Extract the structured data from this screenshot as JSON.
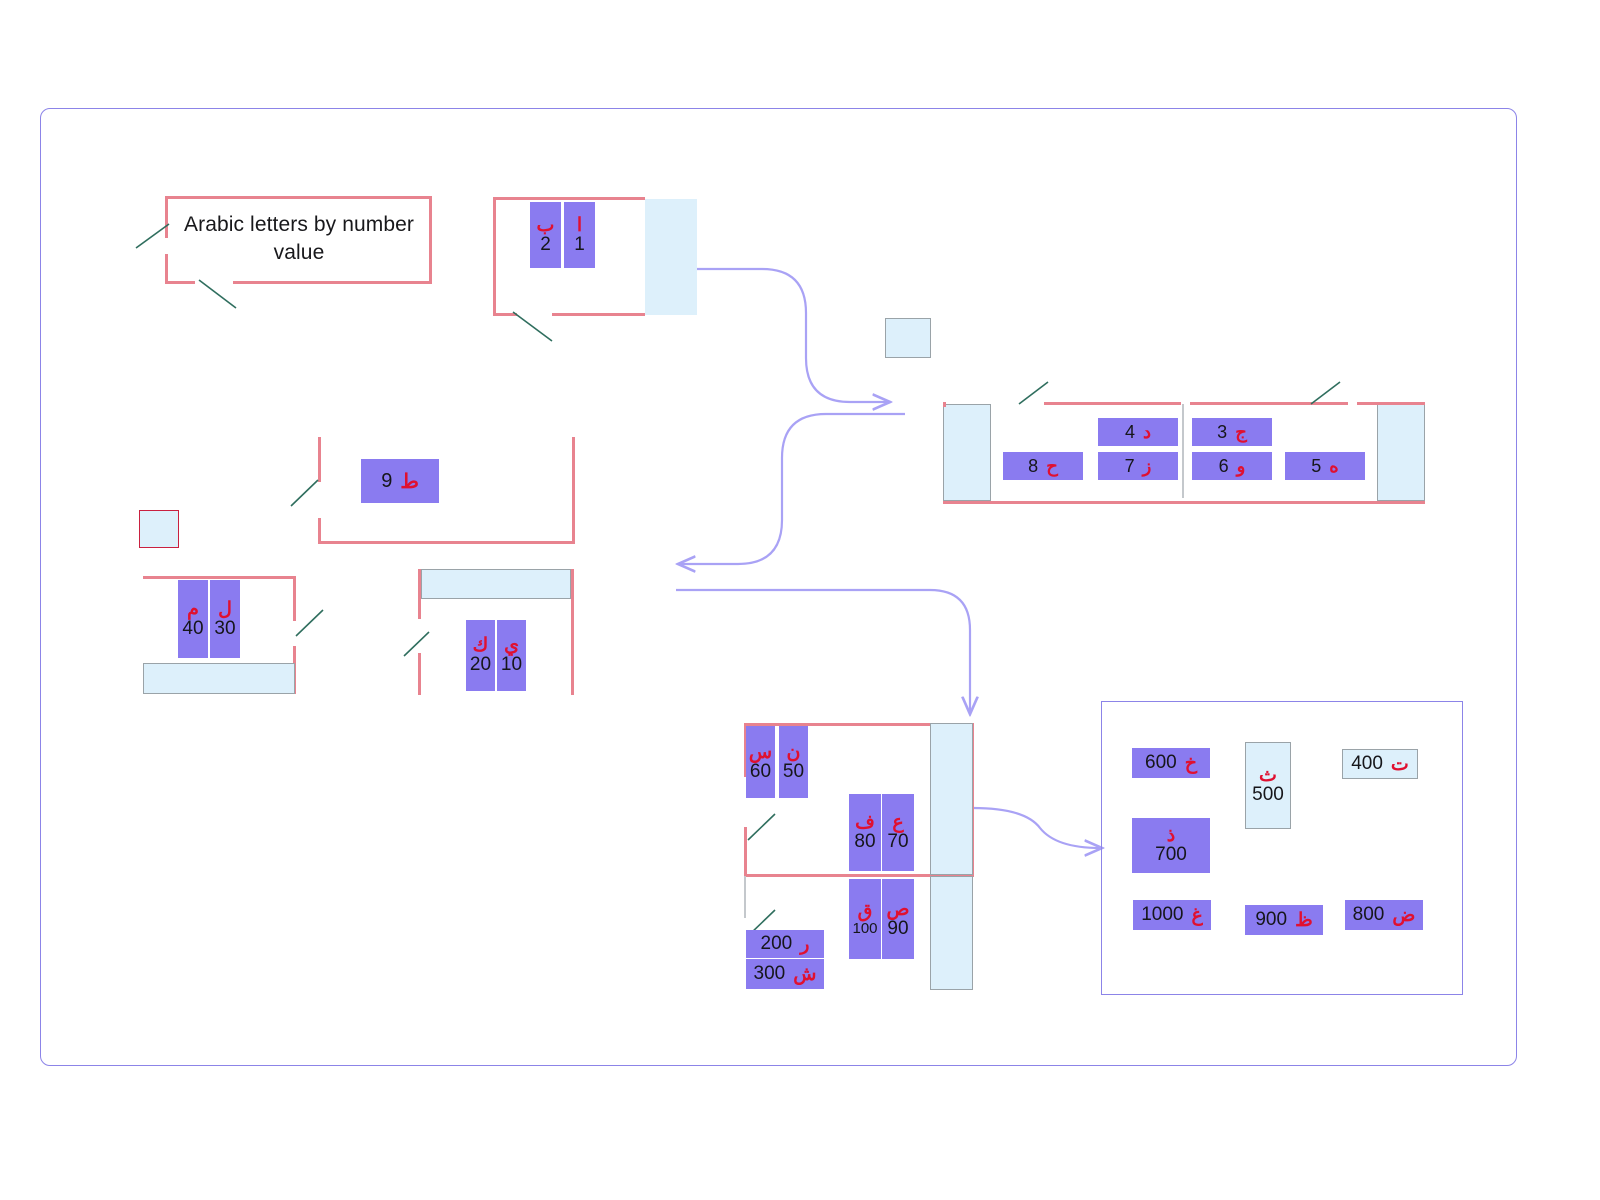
{
  "diagram": {
    "title": "Arabic letters by number value",
    "colors": {
      "chip_purple": "#8a7bf0",
      "chip_blue": "#ddf0fb",
      "letter_red": "#e01030",
      "frame_pink": "#e8838f",
      "frame_darkpink": "#c9203f",
      "connector_purple": "#a9a2f5",
      "leader_green": "#2f6e5e",
      "outer_border": "#8c84e8"
    }
  },
  "groups": {
    "ones_1_2": {
      "name": "ones-1-2",
      "chips": [
        {
          "letter": "ب",
          "value": "2"
        },
        {
          "letter": "ا",
          "value": "1"
        }
      ]
    },
    "ones_3_8": {
      "name": "ones-3-8",
      "chips_left": [
        {
          "letter": "د",
          "value": "4"
        },
        {
          "letter": "ح",
          "value": "8"
        },
        {
          "letter": "ز",
          "value": "7"
        }
      ],
      "chips_right": [
        {
          "letter": "ج",
          "value": "3"
        },
        {
          "letter": "و",
          "value": "6"
        },
        {
          "letter": "ه",
          "value": "5"
        }
      ]
    },
    "nine": {
      "name": "nine",
      "chips": [
        {
          "letter": "ط",
          "value": "9"
        }
      ]
    },
    "tens_10_20": {
      "name": "tens-10-20",
      "chips": [
        {
          "letter": "ك",
          "value": "20"
        },
        {
          "letter": "ي",
          "value": "10"
        }
      ]
    },
    "tens_30_40": {
      "name": "tens-30-40",
      "chips": [
        {
          "letter": "م",
          "value": "40"
        },
        {
          "letter": "ل",
          "value": "30"
        }
      ]
    },
    "tens_50_300": {
      "name": "tens-50-300",
      "chips": [
        {
          "letter": "س",
          "value": "60"
        },
        {
          "letter": "ن",
          "value": "50"
        },
        {
          "letter": "ف",
          "value": "80"
        },
        {
          "letter": "ع",
          "value": "70"
        },
        {
          "letter": "ق",
          "value": "100"
        },
        {
          "letter": "ص",
          "value": "90"
        },
        {
          "letter": "ر",
          "value": "200"
        },
        {
          "letter": "ش",
          "value": "300"
        }
      ]
    },
    "hundreds_400_1000": {
      "name": "hundreds-400-1000",
      "chips": [
        {
          "letter": "خ",
          "value": "600"
        },
        {
          "letter": "ث",
          "value": "500"
        },
        {
          "letter": "ت",
          "value": "400"
        },
        {
          "letter": "ذ",
          "value": "700"
        },
        {
          "letter": "غ",
          "value": "1000"
        },
        {
          "letter": "ظ",
          "value": "900"
        },
        {
          "letter": "ض",
          "value": "800"
        }
      ]
    }
  }
}
